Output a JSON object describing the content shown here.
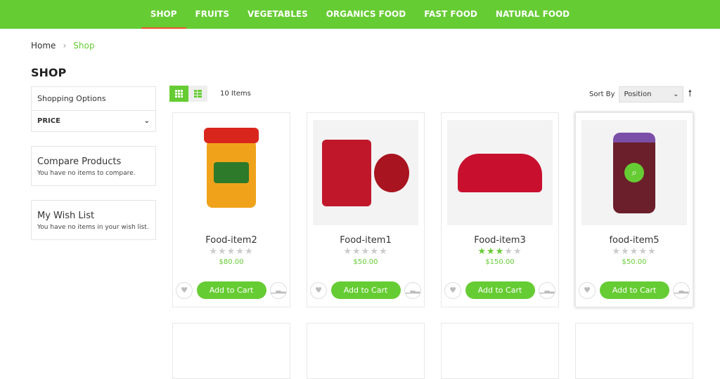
{
  "nav": {
    "items": [
      "SHOP",
      "FRUITS",
      "VEGETABLES",
      "ORGANICS FOOD",
      "FAST FOOD",
      "NATURAL FOOD"
    ],
    "active": "SHOP"
  },
  "breadcrumb": {
    "home": "Home",
    "current": "Shop"
  },
  "page_title": "SHOP",
  "sidebar": {
    "shopping_options": "Shopping Options",
    "price": "PRICE",
    "compare_title": "Compare Products",
    "compare_text": "You have no items to compare.",
    "wish_title": "My Wish List",
    "wish_text": "You have no items in your wish list."
  },
  "toolbar": {
    "count": "10 Items",
    "sort_label": "Sort By",
    "sort_value": "Position"
  },
  "products": [
    {
      "name": "Food-item2",
      "price": "$80.00",
      "rating": 0,
      "cart": "Add to Cart"
    },
    {
      "name": "Food-item1",
      "price": "$50.00",
      "rating": 0,
      "cart": "Add to Cart"
    },
    {
      "name": "Food-item3",
      "price": "$150.00",
      "rating": 2.5,
      "cart": "Add to Cart"
    },
    {
      "name": "food-item5",
      "price": "$50.00",
      "rating": 0,
      "cart": "Add to Cart"
    }
  ],
  "colors": {
    "accent": "#66cc33",
    "active_underline": "#f2552c"
  }
}
